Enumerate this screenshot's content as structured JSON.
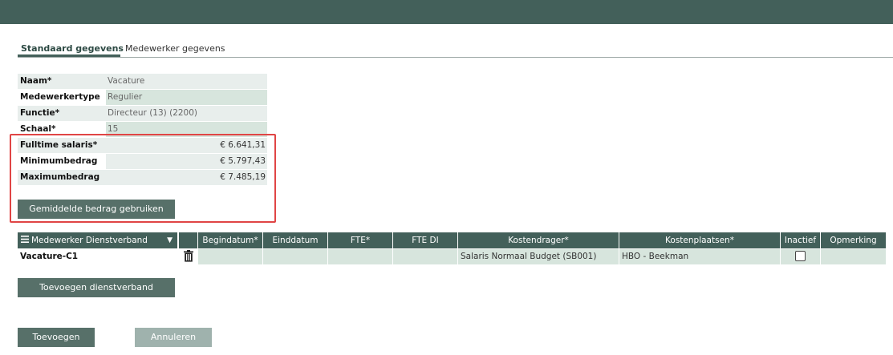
{
  "tabs": [
    {
      "label": "Standaard gegevens",
      "active": true
    },
    {
      "label": "Medewerker gegevens",
      "active": false
    }
  ],
  "form": {
    "rows": [
      {
        "label": "Naam*",
        "value": "Vacature"
      },
      {
        "label": "Medewerkertype",
        "value": "Regulier"
      },
      {
        "label": "Functie*",
        "value": "Directeur (13) (2200)"
      },
      {
        "label": "Schaal*",
        "value": "15"
      },
      {
        "label": "Fulltime salaris*",
        "value": "€ 6.641,31"
      },
      {
        "label": "Minimumbedrag",
        "value": "€ 5.797,43"
      },
      {
        "label": "Maximumbedrag",
        "value": "€ 7.485,19"
      }
    ],
    "average_button": "Gemiddelde bedrag gebruiken"
  },
  "grid": {
    "headers": [
      "Medewerker Dienstverband",
      "",
      "Begindatum*",
      "Einddatum",
      "FTE*",
      "FTE DI",
      "Kostendrager*",
      "Kostenplaatsen*",
      "Inactief",
      "Opmerking"
    ],
    "row": {
      "medewerker": "Vacature-C1",
      "begindatum": "",
      "einddatum": "",
      "fte": "",
      "fte_di": "",
      "kostendrager": "Salaris Normaal Budget (SB001)",
      "kostenplaats": "HBO - Beekman",
      "inactief": false,
      "opmerking": ""
    }
  },
  "buttons": {
    "add_dienstverband": "Toevoegen dienstverband",
    "add": "Toevoegen",
    "cancel": "Annuleren"
  },
  "icons": {
    "menu": "hamburger-icon",
    "caret": "caret-down-icon",
    "trash": "trash-icon"
  },
  "colors": {
    "header": "#43605a",
    "button": "#577069",
    "button_disabled": "#9fb2ad",
    "highlight": "#e04545"
  }
}
